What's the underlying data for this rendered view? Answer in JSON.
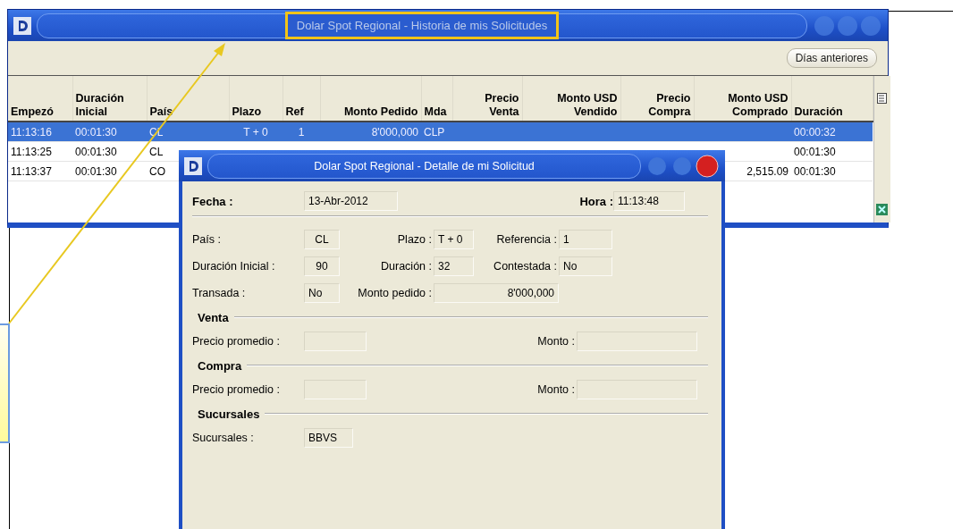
{
  "history_window": {
    "title": "Dolar Spot Regional - Historia de mis Solicitudes",
    "toolbar_button": "Días anteriores",
    "table": {
      "columns": [
        "Empezó",
        "Duración Inicial",
        "País",
        "Plazo",
        "Ref",
        "Monto Pedido",
        "Mda",
        "Precio Venta",
        "Monto USD Vendido",
        "Precio Compra",
        "Monto USD Comprado",
        "Duración"
      ],
      "rows": [
        {
          "selected": true,
          "cells": [
            "11:13:16",
            "00:01:30",
            "CL",
            "T + 0",
            "1",
            "8'000,000",
            "CLP",
            null,
            null,
            null,
            null,
            "00:00:32"
          ]
        },
        {
          "selected": false,
          "cells": [
            "11:13:25",
            "00:01:30",
            "CL",
            null,
            null,
            null,
            null,
            null,
            null,
            null,
            null,
            "00:01:30"
          ]
        },
        {
          "selected": false,
          "cells": [
            "11:13:37",
            "00:01:30",
            "CO",
            null,
            null,
            null,
            null,
            null,
            null,
            null,
            "2,515.09",
            "00:01:30"
          ]
        }
      ]
    }
  },
  "detail_window": {
    "title": "Dolar Spot Regional - Detalle de mi Solicitud",
    "date": {
      "label": "Fecha :",
      "value": "13-Abr-2012"
    },
    "time": {
      "label": "Hora :",
      "value": "11:13:48"
    },
    "rows": [
      {
        "kind": "triple",
        "fields": [
          {
            "label": "País :",
            "value": "CL"
          },
          {
            "label": "Plazo :",
            "value": "T + 0"
          },
          {
            "label": "Referencia :",
            "value": "1"
          }
        ]
      },
      {
        "kind": "triple",
        "fields": [
          {
            "label": "Duración Inicial :",
            "value": "90"
          },
          {
            "label": "Duración :",
            "value": "32"
          },
          {
            "label": "Contestada :",
            "value": "No"
          }
        ]
      },
      {
        "kind": "wide",
        "fields": [
          {
            "label": "Transada :",
            "value": "No"
          },
          {
            "label": "Monto pedido :",
            "value": "8'000,000"
          }
        ]
      },
      {
        "kind": "section",
        "title": "Venta"
      },
      {
        "kind": "pair",
        "fields": [
          {
            "label": "Precio promedio :"
          },
          {
            "label": "Monto :"
          }
        ]
      },
      {
        "kind": "section",
        "title": "Compra"
      },
      {
        "kind": "pair",
        "fields": [
          {
            "label": "Precio promedio :"
          },
          {
            "label": "Monto :"
          }
        ]
      },
      {
        "kind": "section",
        "title": "Sucursales"
      },
      {
        "kind": "single",
        "fields": [
          {
            "label": "Sucursales :",
            "value": "BBVS"
          }
        ]
      }
    ]
  }
}
